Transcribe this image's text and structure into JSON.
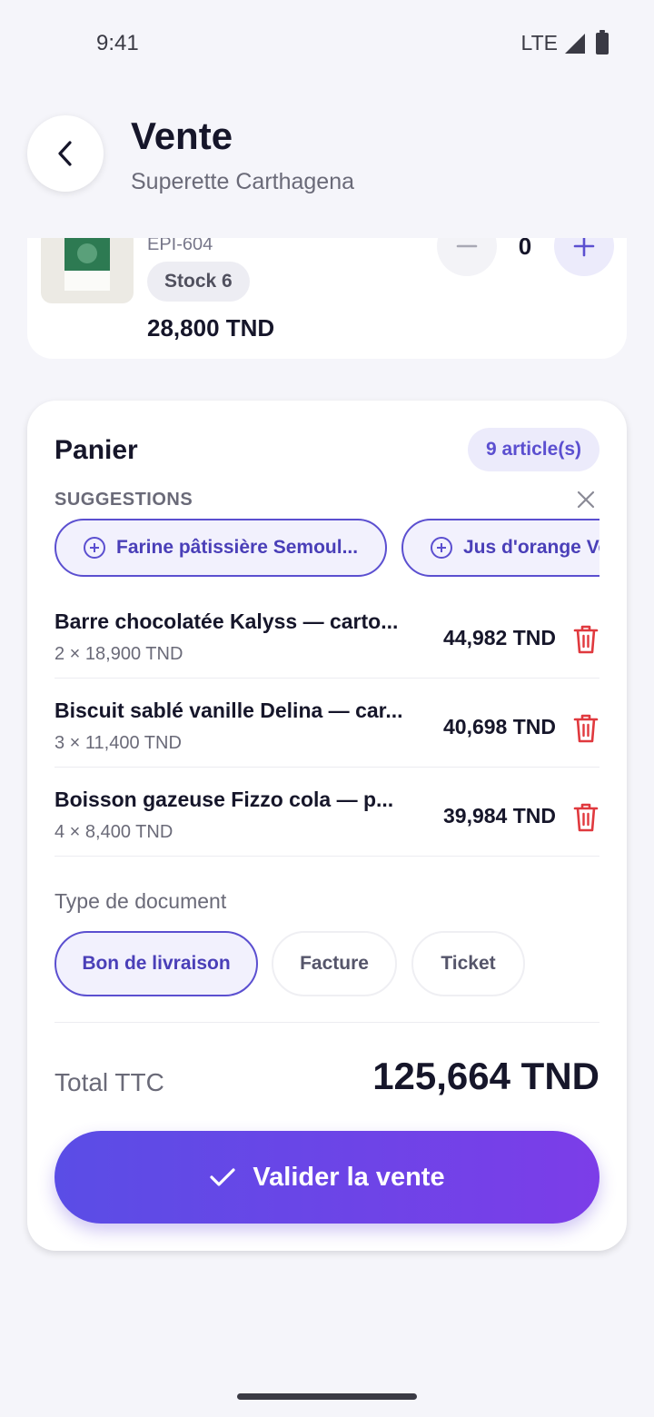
{
  "status_bar": {
    "time": "9:41",
    "network": "LTE"
  },
  "header": {
    "title": "Vente",
    "subtitle": "Superette Carthagena"
  },
  "product": {
    "ref": "EPI-604",
    "stock": "Stock 6",
    "price": "28,800 TND",
    "quantity": "0"
  },
  "cart": {
    "title": "Panier",
    "count": "9 article(s)",
    "suggestions_heading": "SUGGESTIONS",
    "suggestions": [
      {
        "label": "Farine pâtissière Semoul..."
      },
      {
        "label": "Jus d'orange Ve"
      }
    ],
    "items": [
      {
        "name": "Barre chocolatée Kalyss — carto...",
        "detail": "2 × 18,900 TND",
        "total": "44,982 TND"
      },
      {
        "name": "Biscuit sablé vanille Delina — car...",
        "detail": "3 × 11,400 TND",
        "total": "40,698 TND"
      },
      {
        "name": "Boisson gazeuse Fizzo cola — p...",
        "detail": "4 × 8,400 TND",
        "total": "39,984 TND"
      }
    ],
    "doc_type_label": "Type de document",
    "doc_types": [
      {
        "label": "Bon de livraison",
        "active": true
      },
      {
        "label": "Facture",
        "active": false
      },
      {
        "label": "Ticket",
        "active": false
      }
    ],
    "total_label": "Total TTC",
    "total_value": "125,664 TND",
    "validate_label": "Valider la vente"
  },
  "colors": {
    "accent": "#5b4fd0",
    "danger": "#e0393e",
    "gradient_start": "#5a4de6",
    "gradient_end": "#7c3de8"
  }
}
